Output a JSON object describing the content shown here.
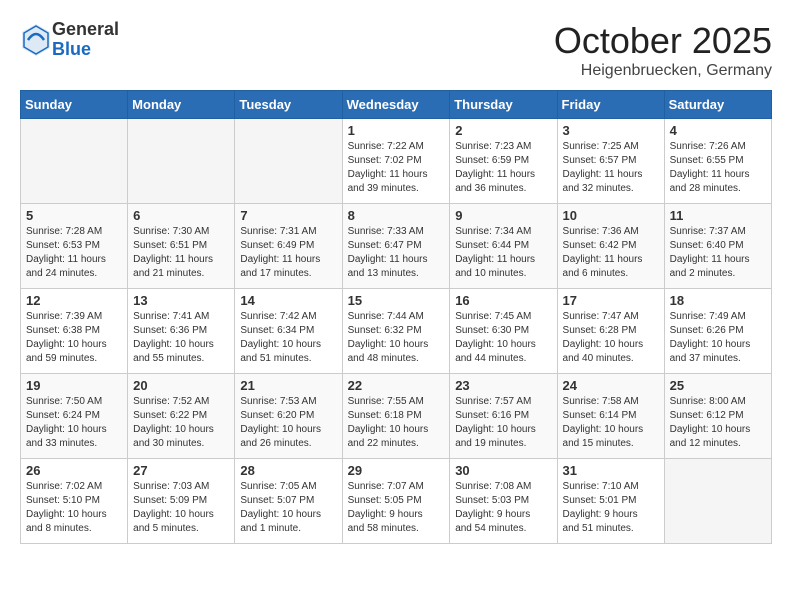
{
  "header": {
    "logo_general": "General",
    "logo_blue": "Blue",
    "month": "October 2025",
    "location": "Heigenbruecken, Germany"
  },
  "days_of_week": [
    "Sunday",
    "Monday",
    "Tuesday",
    "Wednesday",
    "Thursday",
    "Friday",
    "Saturday"
  ],
  "weeks": [
    [
      {
        "day": "",
        "info": ""
      },
      {
        "day": "",
        "info": ""
      },
      {
        "day": "",
        "info": ""
      },
      {
        "day": "1",
        "info": "Sunrise: 7:22 AM\nSunset: 7:02 PM\nDaylight: 11 hours\nand 39 minutes."
      },
      {
        "day": "2",
        "info": "Sunrise: 7:23 AM\nSunset: 6:59 PM\nDaylight: 11 hours\nand 36 minutes."
      },
      {
        "day": "3",
        "info": "Sunrise: 7:25 AM\nSunset: 6:57 PM\nDaylight: 11 hours\nand 32 minutes."
      },
      {
        "day": "4",
        "info": "Sunrise: 7:26 AM\nSunset: 6:55 PM\nDaylight: 11 hours\nand 28 minutes."
      }
    ],
    [
      {
        "day": "5",
        "info": "Sunrise: 7:28 AM\nSunset: 6:53 PM\nDaylight: 11 hours\nand 24 minutes."
      },
      {
        "day": "6",
        "info": "Sunrise: 7:30 AM\nSunset: 6:51 PM\nDaylight: 11 hours\nand 21 minutes."
      },
      {
        "day": "7",
        "info": "Sunrise: 7:31 AM\nSunset: 6:49 PM\nDaylight: 11 hours\nand 17 minutes."
      },
      {
        "day": "8",
        "info": "Sunrise: 7:33 AM\nSunset: 6:47 PM\nDaylight: 11 hours\nand 13 minutes."
      },
      {
        "day": "9",
        "info": "Sunrise: 7:34 AM\nSunset: 6:44 PM\nDaylight: 11 hours\nand 10 minutes."
      },
      {
        "day": "10",
        "info": "Sunrise: 7:36 AM\nSunset: 6:42 PM\nDaylight: 11 hours\nand 6 minutes."
      },
      {
        "day": "11",
        "info": "Sunrise: 7:37 AM\nSunset: 6:40 PM\nDaylight: 11 hours\nand 2 minutes."
      }
    ],
    [
      {
        "day": "12",
        "info": "Sunrise: 7:39 AM\nSunset: 6:38 PM\nDaylight: 10 hours\nand 59 minutes."
      },
      {
        "day": "13",
        "info": "Sunrise: 7:41 AM\nSunset: 6:36 PM\nDaylight: 10 hours\nand 55 minutes."
      },
      {
        "day": "14",
        "info": "Sunrise: 7:42 AM\nSunset: 6:34 PM\nDaylight: 10 hours\nand 51 minutes."
      },
      {
        "day": "15",
        "info": "Sunrise: 7:44 AM\nSunset: 6:32 PM\nDaylight: 10 hours\nand 48 minutes."
      },
      {
        "day": "16",
        "info": "Sunrise: 7:45 AM\nSunset: 6:30 PM\nDaylight: 10 hours\nand 44 minutes."
      },
      {
        "day": "17",
        "info": "Sunrise: 7:47 AM\nSunset: 6:28 PM\nDaylight: 10 hours\nand 40 minutes."
      },
      {
        "day": "18",
        "info": "Sunrise: 7:49 AM\nSunset: 6:26 PM\nDaylight: 10 hours\nand 37 minutes."
      }
    ],
    [
      {
        "day": "19",
        "info": "Sunrise: 7:50 AM\nSunset: 6:24 PM\nDaylight: 10 hours\nand 33 minutes."
      },
      {
        "day": "20",
        "info": "Sunrise: 7:52 AM\nSunset: 6:22 PM\nDaylight: 10 hours\nand 30 minutes."
      },
      {
        "day": "21",
        "info": "Sunrise: 7:53 AM\nSunset: 6:20 PM\nDaylight: 10 hours\nand 26 minutes."
      },
      {
        "day": "22",
        "info": "Sunrise: 7:55 AM\nSunset: 6:18 PM\nDaylight: 10 hours\nand 22 minutes."
      },
      {
        "day": "23",
        "info": "Sunrise: 7:57 AM\nSunset: 6:16 PM\nDaylight: 10 hours\nand 19 minutes."
      },
      {
        "day": "24",
        "info": "Sunrise: 7:58 AM\nSunset: 6:14 PM\nDaylight: 10 hours\nand 15 minutes."
      },
      {
        "day": "25",
        "info": "Sunrise: 8:00 AM\nSunset: 6:12 PM\nDaylight: 10 hours\nand 12 minutes."
      }
    ],
    [
      {
        "day": "26",
        "info": "Sunrise: 7:02 AM\nSunset: 5:10 PM\nDaylight: 10 hours\nand 8 minutes."
      },
      {
        "day": "27",
        "info": "Sunrise: 7:03 AM\nSunset: 5:09 PM\nDaylight: 10 hours\nand 5 minutes."
      },
      {
        "day": "28",
        "info": "Sunrise: 7:05 AM\nSunset: 5:07 PM\nDaylight: 10 hours\nand 1 minute."
      },
      {
        "day": "29",
        "info": "Sunrise: 7:07 AM\nSunset: 5:05 PM\nDaylight: 9 hours\nand 58 minutes."
      },
      {
        "day": "30",
        "info": "Sunrise: 7:08 AM\nSunset: 5:03 PM\nDaylight: 9 hours\nand 54 minutes."
      },
      {
        "day": "31",
        "info": "Sunrise: 7:10 AM\nSunset: 5:01 PM\nDaylight: 9 hours\nand 51 minutes."
      },
      {
        "day": "",
        "info": ""
      }
    ]
  ]
}
